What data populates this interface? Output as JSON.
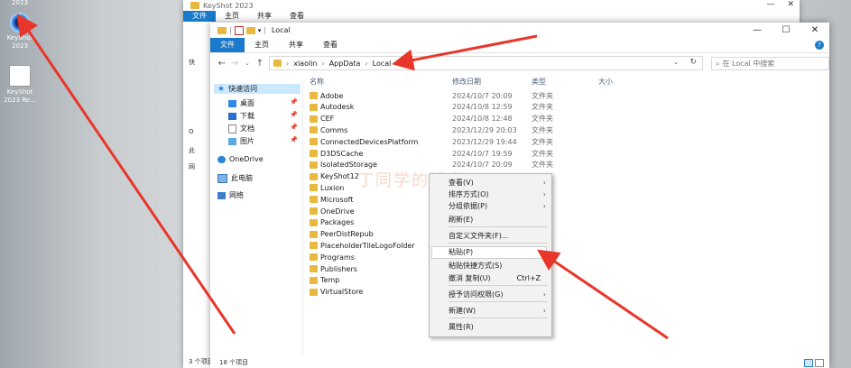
{
  "desktop": {
    "icons": [
      {
        "label": "2023"
      },
      {
        "label": "KeyShot 2023"
      },
      {
        "label": "KeyShot 2023 Re..."
      }
    ]
  },
  "back_window": {
    "title": "KeyShot 2023",
    "ribbon": [
      "文件",
      "主页",
      "共享",
      "查看"
    ],
    "left_pane": [
      "快",
      "O",
      "此",
      "网"
    ],
    "status": "3 个项目"
  },
  "window": {
    "title": "Local",
    "ribbon": [
      "文件",
      "主页",
      "共享",
      "查看"
    ],
    "help": "?",
    "breadcrumb": [
      "xiaolin",
      "AppData",
      "Local"
    ],
    "search_placeholder": "在 Local 中搜索",
    "nav_pane": {
      "quick_access": "快速访问",
      "items": [
        "桌面",
        "下载",
        "文档",
        "图片"
      ],
      "onedrive": "OneDrive",
      "this_pc": "此电脑",
      "network": "网络"
    },
    "columns": {
      "name": "名称",
      "date": "修改日期",
      "type": "类型",
      "size": "大小"
    },
    "files": [
      {
        "name": "Adobe",
        "date": "2024/10/7 20:09",
        "type": "文件夹"
      },
      {
        "name": "Autodesk",
        "date": "2024/10/8 12:59",
        "type": "文件夹"
      },
      {
        "name": "CEF",
        "date": "2024/10/8 12:48",
        "type": "文件夹"
      },
      {
        "name": "Comms",
        "date": "2023/12/29 20:03",
        "type": "文件夹"
      },
      {
        "name": "ConnectedDevicesPlatform",
        "date": "2023/12/29 19:44",
        "type": "文件夹"
      },
      {
        "name": "D3DSCache",
        "date": "2024/10/7 19:59",
        "type": "文件夹"
      },
      {
        "name": "IsolatedStorage",
        "date": "2024/10/7 20:09",
        "type": "文件夹"
      },
      {
        "name": "KeyShot12",
        "date": "",
        "type": ""
      },
      {
        "name": "Luxion",
        "date": "",
        "type": ""
      },
      {
        "name": "Microsoft",
        "date": "",
        "type": ""
      },
      {
        "name": "OneDrive",
        "date": "",
        "type": ""
      },
      {
        "name": "Packages",
        "date": "",
        "type": ""
      },
      {
        "name": "PeerDistRepub",
        "date": "",
        "type": ""
      },
      {
        "name": "PlaceholderTileLogoFolder",
        "date": "",
        "type": ""
      },
      {
        "name": "Programs",
        "date": "",
        "type": ""
      },
      {
        "name": "Publishers",
        "date": "",
        "type": ""
      },
      {
        "name": "Temp",
        "date": "",
        "type": ""
      },
      {
        "name": "VirtualStore",
        "date": "",
        "type": ""
      }
    ],
    "status": "18 个项目"
  },
  "context_menu": {
    "items": [
      {
        "label": "查看(V)",
        "submenu": true
      },
      {
        "label": "排序方式(O)",
        "submenu": true
      },
      {
        "label": "分组依据(P)",
        "submenu": true
      },
      {
        "label": "刷新(E)"
      },
      {
        "label": "自定义文件夹(F)..."
      },
      {
        "label": "粘贴(P)",
        "highlighted": true
      },
      {
        "label": "粘贴快捷方式(S)"
      },
      {
        "label": "撤消 复制(U)",
        "shortcut": "Ctrl+Z"
      },
      {
        "label": "授予访问权限(G)",
        "submenu": true
      },
      {
        "label": "新建(W)",
        "submenu": true
      },
      {
        "label": "属性(R)"
      }
    ]
  },
  "watermark": "丁同学的记本",
  "colors": {
    "accent": "#1979ca",
    "arrow": "#e8362a",
    "folder": "#e8b93e"
  }
}
